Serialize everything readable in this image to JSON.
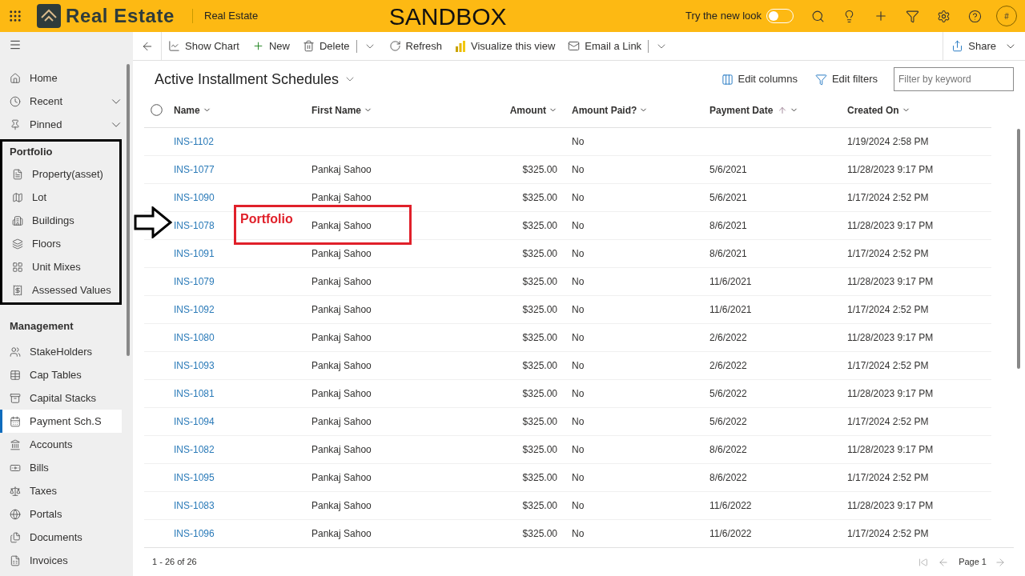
{
  "header": {
    "app_name": "Real Estate",
    "area": "Real Estate",
    "environment": "SANDBOX",
    "new_look": {
      "label": "Try the new look",
      "on": false
    },
    "avatar": "#"
  },
  "command_bar": {
    "items": [
      {
        "kind": "chart",
        "label": "Show Chart"
      },
      {
        "kind": "new",
        "label": "New"
      },
      {
        "kind": "delete",
        "label": "Delete",
        "menu": true
      },
      {
        "kind": "refresh",
        "label": "Refresh"
      },
      {
        "kind": "visualize",
        "label": "Visualize this view"
      },
      {
        "kind": "email",
        "label": "Email a Link",
        "menu": true
      }
    ],
    "share": "Share"
  },
  "sidebar": {
    "top": [
      {
        "kind": "home",
        "label": "Home",
        "expandable": false
      },
      {
        "kind": "recent",
        "label": "Recent",
        "expandable": true
      },
      {
        "kind": "pinned",
        "label": "Pinned",
        "expandable": true
      }
    ],
    "groups": [
      {
        "title": "Portfolio",
        "highlighted": true,
        "items": [
          {
            "kind": "property",
            "label": "Property(asset)",
            "selected": false
          },
          {
            "kind": "lot",
            "label": "Lot",
            "selected": false
          },
          {
            "kind": "buildings",
            "label": "Buildings",
            "selected": false
          },
          {
            "kind": "floors",
            "label": "Floors",
            "selected": false
          },
          {
            "kind": "mixes",
            "label": "Unit Mixes",
            "selected": false
          },
          {
            "kind": "assessed",
            "label": "Assessed Values",
            "selected": false
          }
        ]
      },
      {
        "title": "Management",
        "highlighted": false,
        "items": [
          {
            "kind": "stakeholders",
            "label": "StakeHolders",
            "selected": false
          },
          {
            "kind": "cap",
            "label": "Cap Tables",
            "selected": false
          },
          {
            "kind": "stacks",
            "label": "Capital Stacks",
            "selected": false
          },
          {
            "kind": "payment",
            "label": "Payment Sch.S",
            "selected": true
          },
          {
            "kind": "accounts",
            "label": "Accounts",
            "selected": false
          },
          {
            "kind": "bills",
            "label": "Bills",
            "selected": false
          },
          {
            "kind": "taxes",
            "label": "Taxes",
            "selected": false
          },
          {
            "kind": "portals",
            "label": "Portals",
            "selected": false
          },
          {
            "kind": "documents",
            "label": "Documents",
            "selected": false
          },
          {
            "kind": "invoices",
            "label": "Invoices",
            "selected": false
          }
        ]
      }
    ]
  },
  "view": {
    "title": "Active Installment Schedules",
    "edit_columns": "Edit columns",
    "edit_filters": "Edit filters",
    "filter": {
      "placeholder": "Filter by keyword"
    }
  },
  "table": {
    "all_selected": false,
    "columns": [
      {
        "label": "Name",
        "kind": "text",
        "sorted": false
      },
      {
        "label": "First Name",
        "kind": "text",
        "sorted": false
      },
      {
        "label": "Amount",
        "kind": "money",
        "sorted": false
      },
      {
        "label": "Amount Paid?",
        "kind": "text",
        "sorted": false
      },
      {
        "label": "Payment Date",
        "kind": "text",
        "sorted": true
      },
      {
        "label": "Created On",
        "kind": "text",
        "sorted": false
      }
    ],
    "rows": [
      [
        "INS-1102",
        "",
        "",
        "No",
        "",
        "1/19/2024 2:58 PM"
      ],
      [
        "INS-1077",
        "Pankaj Sahoo",
        "$325.00",
        "No",
        "5/6/2021",
        "11/28/2023 9:17 PM"
      ],
      [
        "INS-1090",
        "Pankaj Sahoo",
        "$325.00",
        "No",
        "5/6/2021",
        "1/17/2024 2:52 PM"
      ],
      [
        "INS-1078",
        "Pankaj Sahoo",
        "$325.00",
        "No",
        "8/6/2021",
        "11/28/2023 9:17 PM"
      ],
      [
        "INS-1091",
        "Pankaj Sahoo",
        "$325.00",
        "No",
        "8/6/2021",
        "1/17/2024 2:52 PM"
      ],
      [
        "INS-1079",
        "Pankaj Sahoo",
        "$325.00",
        "No",
        "11/6/2021",
        "11/28/2023 9:17 PM"
      ],
      [
        "INS-1092",
        "Pankaj Sahoo",
        "$325.00",
        "No",
        "11/6/2021",
        "1/17/2024 2:52 PM"
      ],
      [
        "INS-1080",
        "Pankaj Sahoo",
        "$325.00",
        "No",
        "2/6/2022",
        "11/28/2023 9:17 PM"
      ],
      [
        "INS-1093",
        "Pankaj Sahoo",
        "$325.00",
        "No",
        "2/6/2022",
        "1/17/2024 2:52 PM"
      ],
      [
        "INS-1081",
        "Pankaj Sahoo",
        "$325.00",
        "No",
        "5/6/2022",
        "11/28/2023 9:17 PM"
      ],
      [
        "INS-1094",
        "Pankaj Sahoo",
        "$325.00",
        "No",
        "5/6/2022",
        "1/17/2024 2:52 PM"
      ],
      [
        "INS-1082",
        "Pankaj Sahoo",
        "$325.00",
        "No",
        "8/6/2022",
        "11/28/2023 9:17 PM"
      ],
      [
        "INS-1095",
        "Pankaj Sahoo",
        "$325.00",
        "No",
        "8/6/2022",
        "1/17/2024 2:52 PM"
      ],
      [
        "INS-1083",
        "Pankaj Sahoo",
        "$325.00",
        "No",
        "11/6/2022",
        "11/28/2023 9:17 PM"
      ],
      [
        "INS-1096",
        "Pankaj Sahoo",
        "$325.00",
        "No",
        "11/6/2022",
        "1/17/2024 2:52 PM"
      ]
    ]
  },
  "footer": {
    "count": "1 - 26 of 26",
    "page": "Page 1"
  },
  "annotation": {
    "label": "Portfolio"
  }
}
